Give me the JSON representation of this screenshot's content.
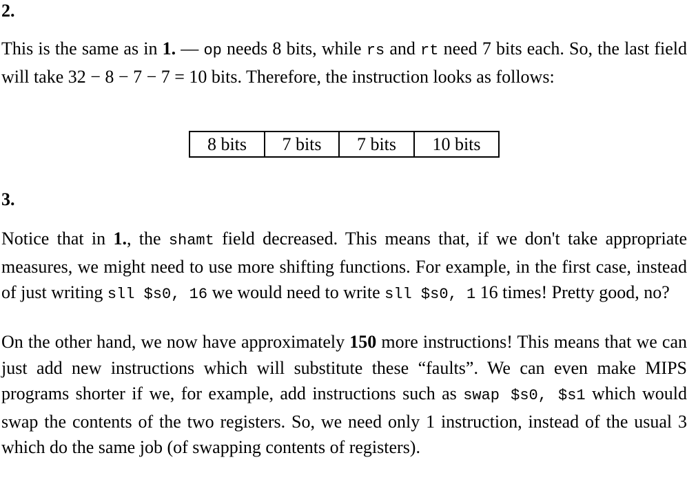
{
  "section2": {
    "heading": "2.",
    "p1": {
      "t1": "This is the same as in ",
      "ref": "1.",
      "t2": " — ",
      "op": "op",
      "t3": " needs 8 bits, while ",
      "rs": "rs",
      "t4": " and ",
      "rt": "rt",
      "t5": " need 7 bits each. So, the last field will take 32 − 8 − 7 − 7 = 10 bits. Therefore, the instruction looks as follows:"
    },
    "fields": [
      "8 bits",
      "7 bits",
      "7 bits",
      "10 bits"
    ]
  },
  "section3": {
    "heading": "3.",
    "p1": {
      "t1": "Notice that in ",
      "ref": "1.",
      "t2": ", the ",
      "shamt": "shamt",
      "t3": " field decreased. This means that, if we don't take appropriate measures, we might need to use more shifting functions. For example, in the first case, instead of just writing ",
      "code1": "sll $s0, 16",
      "t4": " we would need to write ",
      "code2": "sll $s0, 1",
      "t5": " 16 times! Pretty good, no?"
    },
    "p2": {
      "t1": "On the other hand, we now have approximately ",
      "num": "150",
      "t2": " more instructions! This means that we can just add new instructions which will substitute these “faults”. We can even make MIPS programs shorter if we, for example, add instructions such as ",
      "code": "swap $s0, $s1",
      "t3": " which would swap the contents of the two registers. So, we need only 1 instruction, instead of the usual 3 which do the same job (of swapping contents of registers)."
    }
  }
}
